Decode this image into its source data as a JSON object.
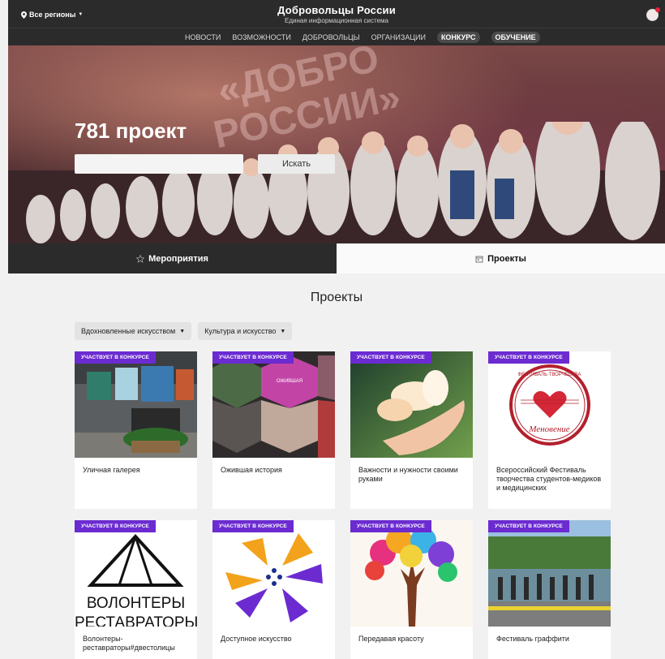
{
  "header": {
    "region": "Все регионы",
    "brand_title": "Добровольцы России",
    "brand_subtitle": "Единая информационная система"
  },
  "nav": {
    "items": [
      "НОВОСТИ",
      "ВОЗМОЖНОСТИ",
      "ДОБРОВОЛЬЦЫ",
      "ОРГАНИЗАЦИИ",
      "КОНКУРС",
      "ОБУЧЕНИЕ"
    ]
  },
  "hero": {
    "sign_text": "«ДОБРО\nРОССИИ»",
    "count": "781 проект",
    "search_placeholder": "",
    "search_button": "Искать"
  },
  "tabs": {
    "events": "Мероприятия",
    "projects": "Проекты"
  },
  "section": {
    "title": "Проекты",
    "filters": [
      "Вдохновленные искусством",
      "Культура и искусство"
    ]
  },
  "cards": [
    {
      "badge": "УЧАСТВУЕТ В КОНКУРСЕ",
      "title": "Уличная галерея"
    },
    {
      "badge": "УЧАСТВУЕТ В КОНКУРСЕ",
      "title": "Ожившая история"
    },
    {
      "badge": "УЧАСТВУЕТ В КОНКУРСЕ",
      "title": "Важности и нужности своими руками"
    },
    {
      "badge": "УЧАСТВУЕТ В КОНКУРСЕ",
      "title": "Всероссийский Фестиваль творчества студентов-медиков и медицинских",
      "logo_text": "Меновение",
      "logo_ring_text": "ФЕСТИВАЛЬ ТВОРЧЕСТВА"
    },
    {
      "badge": "УЧАСТВУЕТ В КОНКУРСЕ",
      "title": "Волонтеры-реставраторы#двестолицы",
      "image_text_1": "ВОЛОНТЕРЫ",
      "image_text_2": "РЕСТАВРАТОРЫ"
    },
    {
      "badge": "УЧАСТВУЕТ В КОНКУРСЕ",
      "title": "Доступное искусство"
    },
    {
      "badge": "УЧАСТВУЕТ В КОНКУРСЕ",
      "title": "Передавая красоту"
    },
    {
      "badge": "УЧАСТВУЕТ В КОНКУРСЕ",
      "title": "Фестиваль граффити"
    }
  ],
  "colors": {
    "header_bg": "#2b2b2b",
    "badge_bg": "#6b2bd1",
    "page_bg": "#f1f1f1"
  },
  "icons": {
    "region": "map-pin-icon",
    "user": "user-avatar-icon",
    "events_tab": "star-icon",
    "projects_tab": "calendar-icon"
  }
}
